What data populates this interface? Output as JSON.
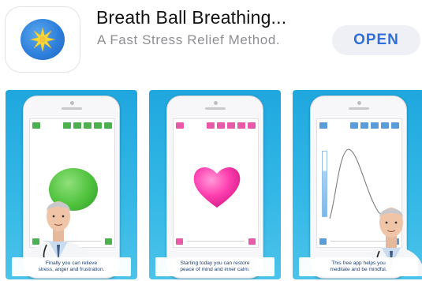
{
  "app": {
    "title": "Breath Ball Breathing...",
    "subtitle": "A Fast Stress Relief Method.",
    "open_label": "OPEN",
    "icon": "blue-ball-star-icon"
  },
  "screenshots": [
    {
      "caption_line1": "Finally you can relieve",
      "caption_line2": "stress, anger and frustration.",
      "visual": "green-ball"
    },
    {
      "caption_line1": "Starting today you can restore",
      "caption_line2": "peace of mind and inner calm.",
      "visual": "pink-heart"
    },
    {
      "caption_line1": "This free app helps you",
      "caption_line2": "meditate and be mindful.",
      "visual": "breathing-curve"
    }
  ],
  "colors": {
    "accent_blue": "#2f6fd9",
    "background_cyan": "#1fa7de",
    "ball_green": "#4fc23d",
    "heart_pink": "#ff3fb0"
  }
}
